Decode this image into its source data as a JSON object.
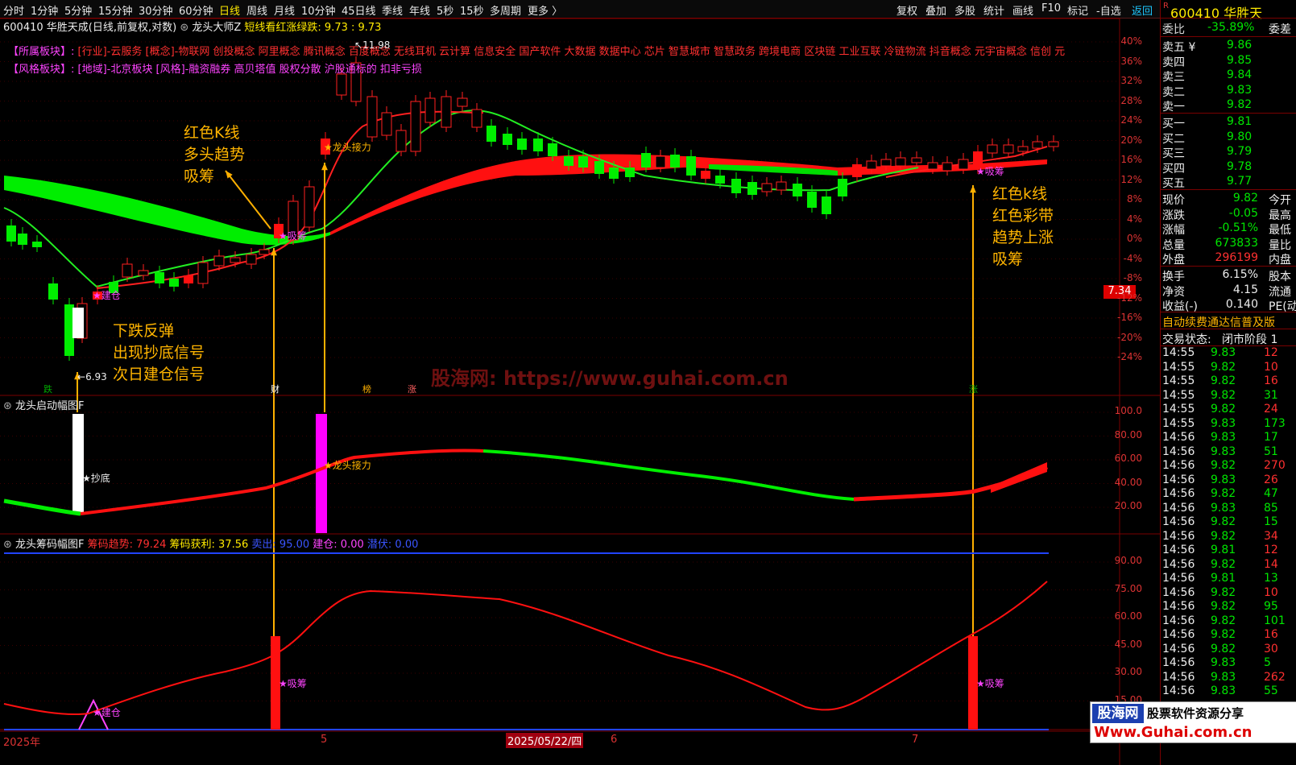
{
  "toolbar": {
    "periods": [
      "分时",
      "1分钟",
      "5分钟",
      "15分钟",
      "30分钟",
      "60分钟",
      "日线",
      "周线",
      "月线",
      "10分钟",
      "45日线",
      "季线",
      "年线",
      "5秒",
      "15秒",
      "多周期",
      "更多 〉"
    ],
    "active_period": "日线",
    "right_buttons": [
      "复权",
      "叠加",
      "多股",
      "统计",
      "画线",
      "F10",
      "标记",
      "-自选",
      "返回"
    ]
  },
  "main_header": {
    "title": "600410 华胜天成(日线,前复权,对数)",
    "indicator_name": "龙头大师Z",
    "indicator_desc": "短线看红涨绿跌: 9.73 : 9.73"
  },
  "sector_rows": {
    "row1_label": "【所属板块】:",
    "row1_text": "[行业]-云服务 [概念]-物联网 创投概念 阿里概念 腾讯概念 百度概念 无线耳机 云计算 信息安全 国产软件 大数据 数据中心 芯片 智慧城市 智慧政务 跨境电商 区块链 工业互联 冷链物流 抖音概念 元宇宙概念 信创 元",
    "row2_label": "【风格板块】:",
    "row2_text": "[地域]-北京板块 [风格]-融资融券 高贝塔值 股权分散 沪股通标的 扣非亏损"
  },
  "price_labels": {
    "high_marker": "11.98",
    "low_marker": "6.93",
    "current_tag": "7.34"
  },
  "main_axis": [
    "40%",
    "36%",
    "32%",
    "28%",
    "24%",
    "20%",
    "16%",
    "12%",
    "8%",
    "4%",
    "0%",
    "-4%",
    "-8%",
    "-12%",
    "-16%",
    "-20%",
    "-24%"
  ],
  "annotations": {
    "a1": [
      "红色K线",
      "多头趋势",
      "吸筹"
    ],
    "a2": [
      "下跌反弹",
      "出现抄底信号",
      "次日建仓信号"
    ],
    "a3": [
      "红色k线",
      "红色彩带",
      "趋势上涨",
      "吸筹"
    ]
  },
  "star_labels": {
    "jiancang": "★建仓",
    "xichou1": "★吸筹",
    "longtou": "★龙头接力",
    "xichou2": "★吸筹",
    "chaodi": "★抄底",
    "longtou2": "★龙头接力",
    "jiancang2": "★建仓",
    "xichou3": "★吸筹",
    "xichou4": "★吸筹"
  },
  "event_tags": [
    "跌",
    "财",
    "榜",
    "涨",
    "涨"
  ],
  "watermark": "股海网: https://www.guhai.com.cn",
  "panel2": {
    "title": "龙头启动幅图F",
    "axis": [
      "100.0",
      "80.00",
      "60.00",
      "40.00",
      "20.00"
    ]
  },
  "panel3": {
    "title": "龙头筹码幅图F",
    "trend_label": "筹码趋势: 79.24",
    "profit_label": "筹码获利: 37.56",
    "sell_label": "卖出: 95.00",
    "build_label": "建仓: 0.00",
    "hide_label": "潜伏: 0.00",
    "axis": [
      "90.00",
      "75.00",
      "60.00",
      "45.00",
      "30.00",
      "15.00"
    ]
  },
  "date_axis": {
    "year": "2025年",
    "m5": "5",
    "cursor_date": "2025/05/22/四",
    "m6": "6",
    "m7": "7"
  },
  "right_panel": {
    "code": "600410",
    "name": "华胜天",
    "weibi_label": "委比",
    "weibi": "-35.89%",
    "weicha_label": "委差",
    "asks": [
      [
        "卖五 ¥",
        "9.86"
      ],
      [
        "卖四",
        "9.85"
      ],
      [
        "卖三",
        "9.84"
      ],
      [
        "卖二",
        "9.83"
      ],
      [
        "卖一",
        "9.82"
      ]
    ],
    "bids": [
      [
        "买一",
        "9.81"
      ],
      [
        "买二",
        "9.80"
      ],
      [
        "买三",
        "9.79"
      ],
      [
        "买四",
        "9.78"
      ],
      [
        "买五",
        "9.77"
      ]
    ],
    "stats": [
      [
        "现价",
        "9.82",
        "今开"
      ],
      [
        "涨跌",
        "-0.05",
        "最高"
      ],
      [
        "涨幅",
        "-0.51%",
        "最低"
      ],
      [
        "总量",
        "673833",
        "量比"
      ],
      [
        "外盘",
        "296199",
        "内盘"
      ]
    ],
    "stats2": [
      [
        "换手",
        "6.15%",
        "股本"
      ],
      [
        "净资",
        "4.15",
        "流通"
      ],
      [
        "收益(-)",
        "0.140",
        "PE(动"
      ]
    ],
    "scroll_text": "自动续费通达信普及版",
    "trade_state_label": "交易状态:",
    "trade_state": "闭市阶段 1",
    "ticks": [
      [
        "14:55",
        "9.83",
        "12"
      ],
      [
        "14:55",
        "9.82",
        "10"
      ],
      [
        "14:55",
        "9.82",
        "16"
      ],
      [
        "14:55",
        "9.82",
        "31"
      ],
      [
        "14:55",
        "9.82",
        "24"
      ],
      [
        "14:55",
        "9.83",
        "173"
      ],
      [
        "14:56",
        "9.83",
        "17"
      ],
      [
        "14:56",
        "9.83",
        "51"
      ],
      [
        "14:56",
        "9.82",
        "270"
      ],
      [
        "14:56",
        "9.83",
        "26"
      ],
      [
        "14:56",
        "9.82",
        "47"
      ],
      [
        "14:56",
        "9.83",
        "85"
      ],
      [
        "14:56",
        "9.82",
        "15"
      ],
      [
        "14:56",
        "9.82",
        "34"
      ],
      [
        "14:56",
        "9.81",
        "12"
      ],
      [
        "14:56",
        "9.82",
        "14"
      ],
      [
        "14:56",
        "9.81",
        "13"
      ],
      [
        "14:56",
        "9.82",
        "10"
      ],
      [
        "14:56",
        "9.82",
        "95"
      ],
      [
        "14:56",
        "9.82",
        "101"
      ],
      [
        "14:56",
        "9.82",
        "16"
      ],
      [
        "14:56",
        "9.82",
        "30"
      ],
      [
        "14:56",
        "9.83",
        "5"
      ],
      [
        "14:56",
        "9.83",
        "262"
      ],
      [
        "14:56",
        "9.83",
        "55"
      ]
    ]
  },
  "logo": {
    "line1": "股海网",
    "line2": "股票软件资源分享",
    "line3": "Www.Guhai.com.cn"
  }
}
